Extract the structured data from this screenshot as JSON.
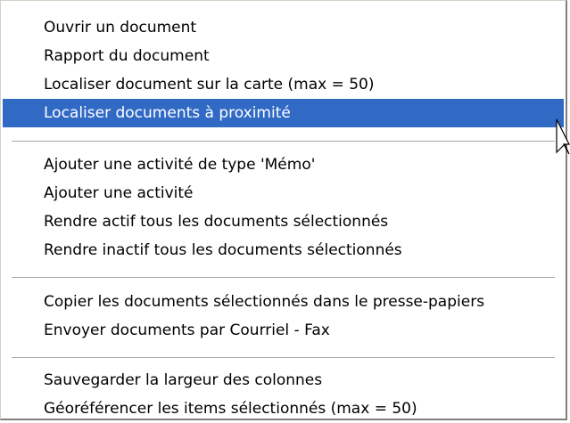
{
  "menu": {
    "items": [
      {
        "label": "Ouvrir un document"
      },
      {
        "label": "Rapport du document"
      },
      {
        "label": "Localiser document sur la carte (max = 50)"
      },
      {
        "label": "Localiser documents à proximité",
        "selected": true
      },
      {
        "label": "Ajouter une activité de type 'Mémo'"
      },
      {
        "label": "Ajouter une activité"
      },
      {
        "label": "Rendre actif tous les documents sélectionnés"
      },
      {
        "label": "Rendre inactif tous les documents sélectionnés"
      },
      {
        "label": "Copier les documents sélectionnés dans le presse-papiers"
      },
      {
        "label": "Envoyer documents par Courriel - Fax"
      },
      {
        "label": "Sauvegarder la largeur des colonnes"
      },
      {
        "label": "Géoréférencer les items sélectionnés (max = 50)"
      }
    ]
  },
  "colors": {
    "highlight": "#316ac5",
    "highlight_text": "#ffffff",
    "text": "#000000",
    "separator": "#a7a6aa"
  },
  "icons": {
    "cursor": "mouse-pointer-icon"
  }
}
